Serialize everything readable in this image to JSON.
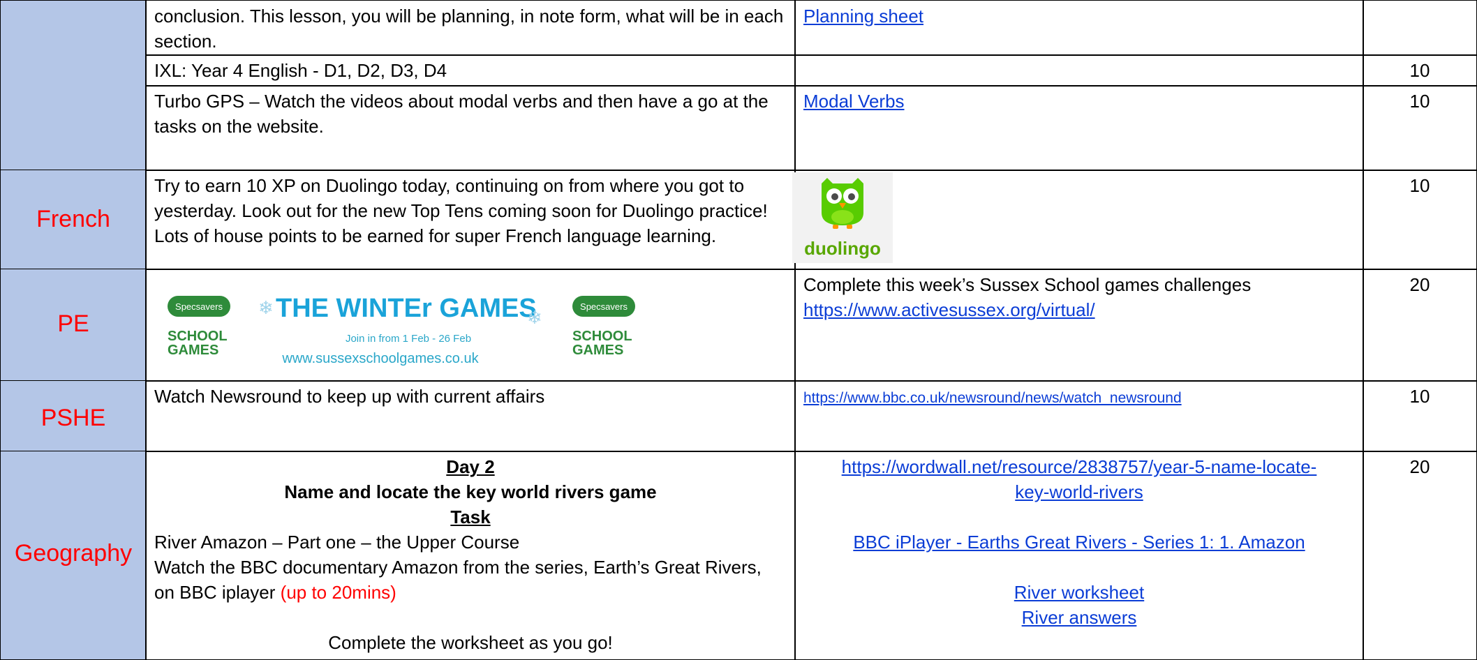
{
  "rows": {
    "english": {
      "r1_text": "conclusion. This lesson, you will be planning, in note form, what will be in each section.",
      "r1_link": "Planning sheet",
      "r2_text": "IXL: Year 4 English -  D1, D2, D3, D4",
      "r2_points": "10",
      "r3_text": "Turbo GPS – Watch the videos about modal verbs and then have a go at the tasks on the website.",
      "r3_link": "Modal Verbs",
      "r3_points": "10"
    },
    "french": {
      "subject": "French",
      "text": "Try to earn 10 XP on Duolingo today, continuing on from where you got to yesterday. Look out for the new Top Tens coming soon for Duolingo practice! Lots of house points to be earned for super French language learning.",
      "logo_text": "duolingo",
      "points": "10"
    },
    "pe": {
      "subject": "PE",
      "banner_title": "THE WINTEr GAMES",
      "banner_sponsor": "Specsavers",
      "banner_school_line1": "SCHOOL",
      "banner_school_line2": "GAMES",
      "banner_dates": "Join in from 1 Feb - 26 Feb",
      "banner_url": "www.sussexschoolgames.co.uk",
      "text": "Complete this week’s Sussex School games challenges",
      "link": "https://www.activesussex.org/virtual/",
      "points": "20"
    },
    "pshe": {
      "subject": "PSHE",
      "text": "Watch Newsround to keep up with current affairs",
      "link": "https://www.bbc.co.uk/newsround/news/watch_newsround",
      "points": "10"
    },
    "geography": {
      "subject": "Geography",
      "day": "Day 2",
      "heading": "Name and locate the key world rivers game",
      "task": "Task",
      "line1": "River Amazon – Part one – the Upper Course",
      "line2": "Watch the BBC documentary Amazon from the series, Earth’s Great Rivers, on BBC iplayer ",
      "line2_red": "(up to 20mins)",
      "line3": "Complete the worksheet as you go!",
      "link1": "https://wordwall.net/resource/2838757/year-5-name-locate-key-world-rivers",
      "link2": "BBC iPlayer - Earths Great Rivers - Series 1: 1. Amazon",
      "link3": "River worksheet",
      "link4": "River answers",
      "points": "20"
    }
  },
  "colors": {
    "subject_bg": "#b4c6e7",
    "subject_text": "#ff0000",
    "link": "#0b3dd6",
    "duolingo_green": "#58cc02"
  }
}
